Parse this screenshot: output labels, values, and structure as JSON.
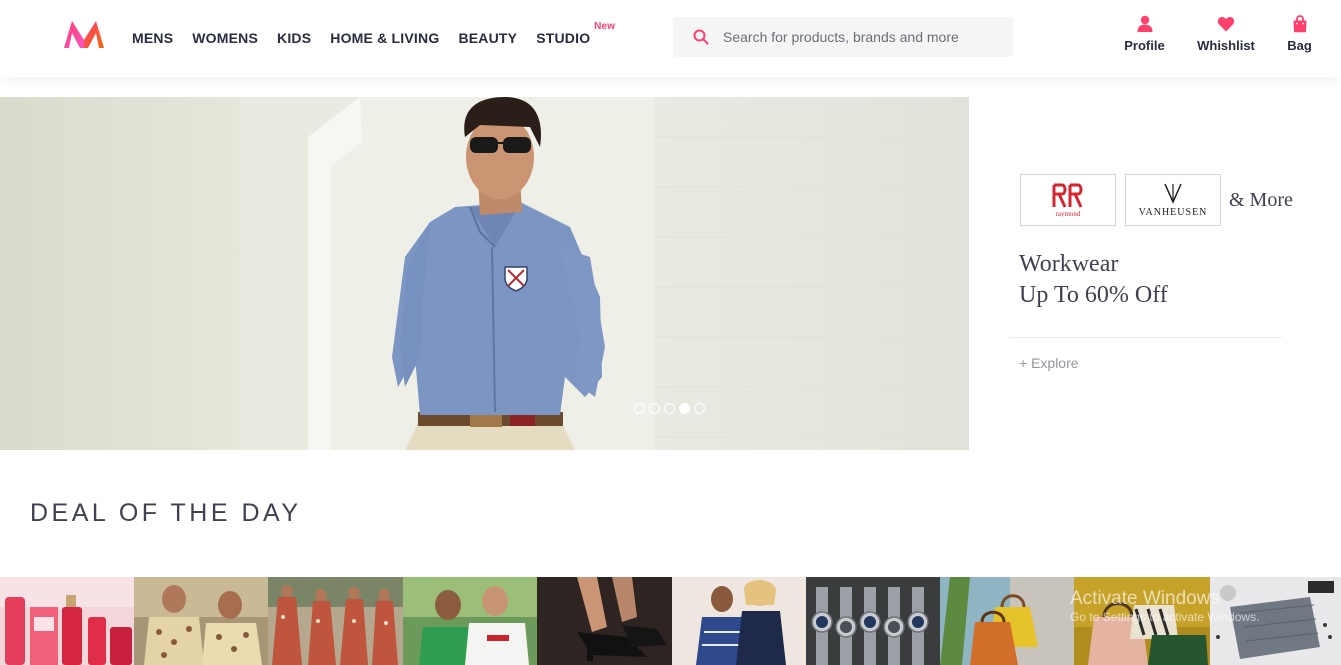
{
  "header": {
    "logo_icon": "myntra-logo-icon",
    "nav": [
      {
        "label": "MENS"
      },
      {
        "label": "WOMENS"
      },
      {
        "label": "KIDS"
      },
      {
        "label": "HOME & LIVING"
      },
      {
        "label": "BEAUTY"
      },
      {
        "label": "STUDIO",
        "badge": "New"
      }
    ],
    "search": {
      "placeholder": "Search for products, brands and more",
      "icon": "search-icon"
    },
    "actions": [
      {
        "label": "Profile",
        "icon": "profile-icon"
      },
      {
        "label": "Whishlist",
        "icon": "heart-icon"
      },
      {
        "label": "Bag",
        "icon": "bag-icon"
      }
    ]
  },
  "hero": {
    "slides_total": 5,
    "active_slide": 4
  },
  "promo": {
    "brands": [
      {
        "name": "Raymond",
        "logo_text": "raymond"
      },
      {
        "name": "Van Heusen",
        "logo_text": "VANHEUSEN"
      }
    ],
    "more": "& More",
    "headline_line1": "Workwear",
    "headline_line2": "Up To 60% Off",
    "explore": "+ Explore"
  },
  "deal_section": {
    "title": "DEAL OF THE DAY",
    "tiles": [
      {
        "name": "deal-tile-fragrance"
      },
      {
        "name": "deal-tile-men-shirts"
      },
      {
        "name": "deal-tile-ethnic-wear"
      },
      {
        "name": "deal-tile-tshirts"
      },
      {
        "name": "deal-tile-heels"
      },
      {
        "name": "deal-tile-dresses"
      },
      {
        "name": "deal-tile-watches"
      },
      {
        "name": "deal-tile-handbags"
      },
      {
        "name": "deal-tile-bags"
      },
      {
        "name": "deal-tile-accessories"
      }
    ]
  },
  "os_watermark": {
    "line1": "Activate Windows",
    "line2": "Go to Settings to activate Windows."
  },
  "colors": {
    "brand_pink": "#ff3f6c",
    "text_dark": "#282c3f",
    "search_bg": "#f5f5f6"
  }
}
